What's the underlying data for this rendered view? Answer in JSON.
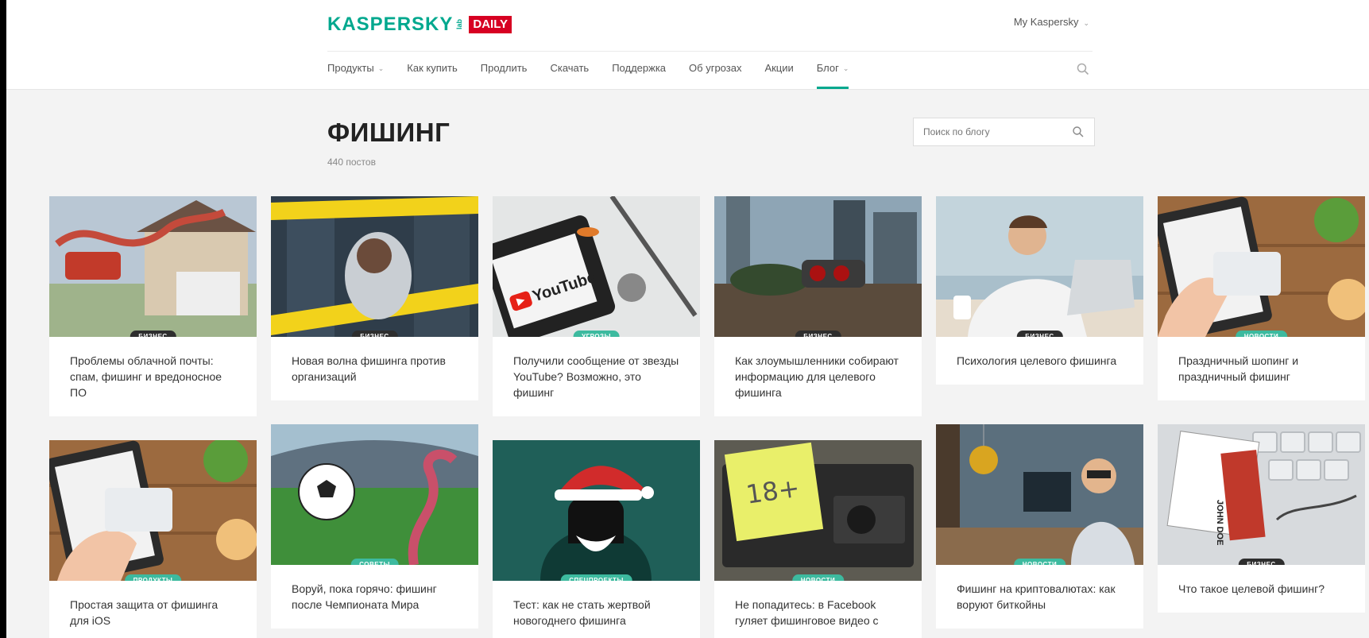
{
  "header": {
    "brand": "KASPERSKY",
    "brand_lab": "lab",
    "brand_daily": "DAILY",
    "account_label": "My Kaspersky"
  },
  "nav": {
    "items": [
      {
        "label": "Продукты",
        "dropdown": true
      },
      {
        "label": "Как купить",
        "dropdown": false
      },
      {
        "label": "Продлить",
        "dropdown": false
      },
      {
        "label": "Скачать",
        "dropdown": false
      },
      {
        "label": "Поддержка",
        "dropdown": false
      },
      {
        "label": "Об угрозах",
        "dropdown": false
      },
      {
        "label": "Акции",
        "dropdown": false
      },
      {
        "label": "Блог",
        "dropdown": true,
        "active": true
      }
    ],
    "search_icon": "search-icon"
  },
  "page": {
    "title": "ФИШИНГ",
    "post_count": "440 постов",
    "search_placeholder": "Поиск по блогу"
  },
  "colors": {
    "accent": "#00a88e",
    "daily_red": "#d70022",
    "badge_dark": "#2e2e2e",
    "badge_teal": "#3dba9f"
  },
  "cards": [
    {
      "badge": "БИЗНЕС",
      "badge_style": "dark",
      "title": "Проблемы облачной почты: спам, фишинг и вредоносное ПО"
    },
    {
      "badge": "БИЗНЕС",
      "badge_style": "dark",
      "title": "Новая волна фишинга против организаций"
    },
    {
      "badge": "УГРОЗЫ",
      "badge_style": "teal",
      "title": "Получили сообщение от звезды YouTube? Возможно, это фишинг",
      "image_text": "YouTube"
    },
    {
      "badge": "БИЗНЕС",
      "badge_style": "dark",
      "title": "Как злоумышленники собирают информацию для целевого фишинга"
    },
    {
      "badge": "БИЗНЕС",
      "badge_style": "dark",
      "title": "Психология целевого фишинга"
    },
    {
      "badge": "НОВОСТИ",
      "badge_style": "teal",
      "title": "Праздничный шопинг и праздничный фишинг"
    },
    {
      "badge": "ПРОДУКТЫ",
      "badge_style": "teal",
      "title": "Простая защита от фишинга для iOS"
    },
    {
      "badge": "СОВЕТЫ",
      "badge_style": "teal",
      "title": "Воруй, пока горячо: фишинг после Чемпионата Мира"
    },
    {
      "badge": "СПЕЦПРОЕКТЫ",
      "badge_style": "teal",
      "title": "Тест: как не стать жертвой новогоднего фишинга"
    },
    {
      "badge": "НОВОСТИ",
      "badge_style": "teal",
      "title": "Не попадитесь: в Facebook гуляет фишинговое видео с",
      "image_text": "18+"
    },
    {
      "badge": "НОВОСТИ",
      "badge_style": "teal",
      "title": "Фишинг на криптовалютах: как воруют биткойны"
    },
    {
      "badge": "БИЗНЕС",
      "badge_style": "dark",
      "title": "Что такое целевой фишинг?",
      "image_text": "JOHN DOE"
    }
  ]
}
